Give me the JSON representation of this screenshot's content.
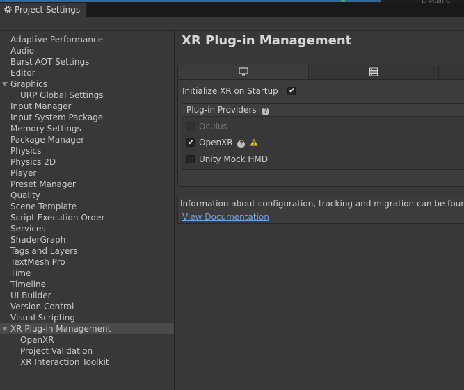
{
  "window": {
    "tab_title": "Project Settings",
    "background_fragment": "LI Main C"
  },
  "sidebar": {
    "items": [
      {
        "label": "Adaptive Performance"
      },
      {
        "label": "Audio"
      },
      {
        "label": "Burst AOT Settings"
      },
      {
        "label": "Editor"
      },
      {
        "label": "Graphics",
        "expanded": true
      },
      {
        "label": "URP Global Settings",
        "child": true
      },
      {
        "label": "Input Manager"
      },
      {
        "label": "Input System Package"
      },
      {
        "label": "Memory Settings"
      },
      {
        "label": "Package Manager"
      },
      {
        "label": "Physics"
      },
      {
        "label": "Physics 2D"
      },
      {
        "label": "Player"
      },
      {
        "label": "Preset Manager"
      },
      {
        "label": "Quality"
      },
      {
        "label": "Scene Template"
      },
      {
        "label": "Script Execution Order"
      },
      {
        "label": "Services"
      },
      {
        "label": "ShaderGraph"
      },
      {
        "label": "Tags and Layers"
      },
      {
        "label": "TextMesh Pro"
      },
      {
        "label": "Time"
      },
      {
        "label": "Timeline"
      },
      {
        "label": "UI Builder"
      },
      {
        "label": "Version Control"
      },
      {
        "label": "Visual Scripting"
      },
      {
        "label": "XR Plug-in Management",
        "expanded": true,
        "selected": true
      },
      {
        "label": "OpenXR",
        "child": true
      },
      {
        "label": "Project Validation",
        "child": true
      },
      {
        "label": "XR Interaction Toolkit",
        "child": true
      }
    ]
  },
  "main": {
    "title": "XR Plug-in Management",
    "platform_tabs": [
      {
        "icon": "monitor-icon",
        "active": true
      },
      {
        "icon": "server-icon",
        "active": false
      },
      {
        "icon": "android-icon",
        "active": false
      }
    ],
    "initialize_label": "Initialize XR on Startup",
    "initialize_checked": true,
    "providers_title": "Plug-in Providers",
    "providers": [
      {
        "name": "Oculus",
        "checked": false,
        "disabled": true
      },
      {
        "name": "OpenXR",
        "checked": true,
        "help": true,
        "warning": true
      },
      {
        "name": "Unity Mock HMD",
        "checked": false
      }
    ],
    "info_text": "Information about configuration, tracking and migration can be found below.",
    "info_link": "View Documentation"
  },
  "colors": {
    "accent_link": "#6ea4e8",
    "selection": "#4a4a4a",
    "warning": "#f0c419"
  }
}
